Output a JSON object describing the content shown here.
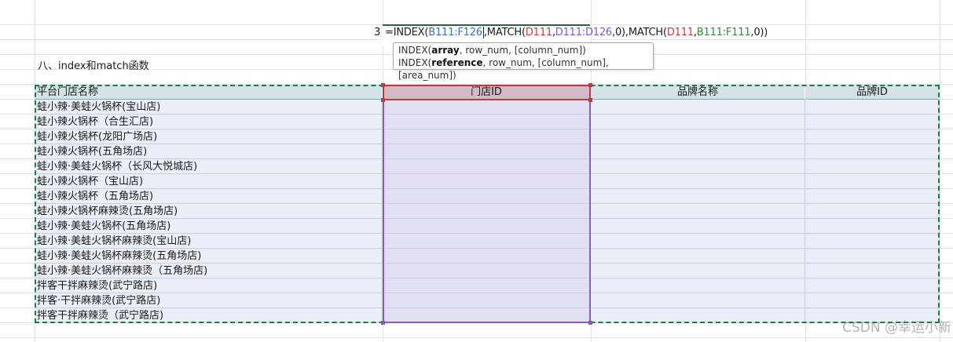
{
  "formula": {
    "row_number": "3",
    "parts": [
      {
        "text": "=INDEX(",
        "color": "default"
      },
      {
        "text": "B111:F126",
        "color": "blue"
      },
      {
        "text": ",MATCH(",
        "color": "default"
      },
      {
        "text": "D111",
        "color": "red"
      },
      {
        "text": ",",
        "color": "default"
      },
      {
        "text": "D111:D126",
        "color": "purple"
      },
      {
        "text": ",0),MATCH(",
        "color": "default"
      },
      {
        "text": "D111",
        "color": "red"
      },
      {
        "text": ",",
        "color": "default"
      },
      {
        "text": "B111:F111",
        "color": "green"
      },
      {
        "text": ",0))",
        "color": "default"
      }
    ]
  },
  "tooltip": {
    "line1_fn": "INDEX(",
    "line1_bold": "array",
    "line1_rest": ", row_num, [column_num])",
    "line2_fn": "INDEX(",
    "line2_bold": "reference",
    "line2_rest": ", row_num, [column_num], [area_num])"
  },
  "section_title": "八、index和match函数",
  "table": {
    "headers": [
      "平台门店名称",
      "门店ID",
      "品牌名称",
      "品牌ID"
    ],
    "rows": [
      "蛙小辣·美蛙火锅杯(宝山店)",
      "蛙小辣火锅杯（合生汇店)",
      "蛙小辣火锅杯(龙阳广场店)",
      "蛙小辣火锅杯(五角场店)",
      "蛙小辣·美蛙火锅杯（长风大悦城店)",
      "蛙小辣火锅杯（宝山店)",
      "蛙小辣火锅杯（五角场店)",
      "蛙小辣火锅杯麻辣烫(五角场店)",
      "蛙小辣·美蛙火锅杯(五角场店)",
      "蛙小辣·美蛙火锅杯麻辣烫(宝山店)",
      "蛙小辣·美蛙火锅杯麻辣烫(五角场店)",
      "蛙小辣·美蛙火锅杯麻辣烫（五角场店)",
      "拌客干拌麻辣烫(武宁路店)",
      "拌客·干拌麻辣烫(武宁路店)",
      "拌客干拌麻辣烫（武宁路店)"
    ]
  },
  "watermark": "CSDN @幸运小新",
  "colors": {
    "ref_blue": "#3f6fbf",
    "ref_red": "#d03a3a",
    "ref_purple": "#7c5cc4",
    "ref_green": "#2c8c3f"
  }
}
